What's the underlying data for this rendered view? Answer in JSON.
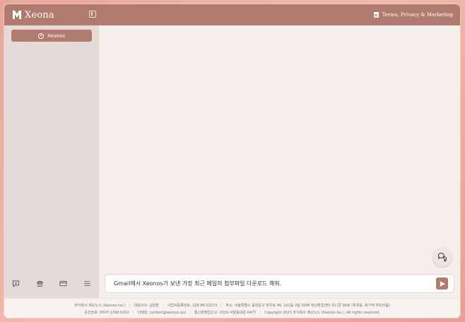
{
  "header": {
    "brand": "Xeona",
    "terms_label": "Terms, Privacy & Marketing"
  },
  "sidebar": {
    "user_label": "Xeonos",
    "icons": [
      "new-chat-icon",
      "phone-icon",
      "card-icon",
      "menu-icon"
    ]
  },
  "input": {
    "value": "Gmail에서 Xeonos가 보낸 가장 최근 메일의 첨부파일 다운로드 해줘."
  },
  "footer": {
    "line1": [
      "주식회사 제오노스 (Xeonos Inc.)",
      "대표이사: 김양훈",
      "사업자등록번호: 228-86-03273",
      "주소: 서울특별시 동대문구 망우로 46, 101동 2층 DDM 청년창업센터 유니콘 06호 (휘경동, 회기역 하트리움)"
    ],
    "line2": [
      "유선번호: 0507-1398-5302",
      "이메일: contact@xeonos.xyz",
      "통신판매업신고: 2025-서울동대문-0477",
      "Copyright 2025 주식회사 제오노스 (Xeonos Inc.). All rights reserved."
    ]
  },
  "colors": {
    "accent": "#b07a6e",
    "sidebar_bg": "#e5dad7",
    "main_bg": "#f5eeeb"
  }
}
